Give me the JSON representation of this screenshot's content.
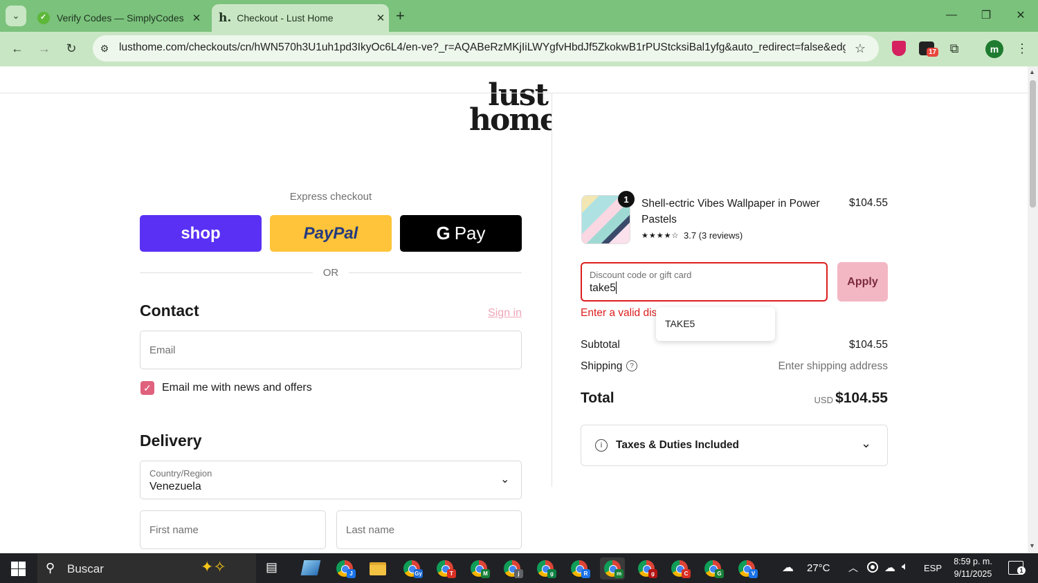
{
  "browser": {
    "tabs": [
      {
        "title": "Verify Codes — SimplyCodes"
      },
      {
        "title": "Checkout - Lust Home"
      }
    ],
    "new_tab": "+",
    "url": "lusthome.com/checkouts/cn/hWN570h3U1uh1pd3IkyOc6L4/en-ve?_r=AQABeRzMKjIiLWYgfvHbdJf5ZkokwB1rPUStcksiBal1yfg&auto_redirect=false&edg...",
    "extension_badge": "17",
    "profile_initial": "m"
  },
  "brand": {
    "line1": "lust",
    "line2": "home."
  },
  "express": {
    "label": "Express checkout",
    "shop": "shop",
    "paypal": "PayPal",
    "gpay": "Pay",
    "or": "OR"
  },
  "contact": {
    "title": "Contact",
    "sign_in": "Sign in",
    "email_placeholder": "Email",
    "newsletter": "Email me with news and offers"
  },
  "delivery": {
    "title": "Delivery",
    "country_label": "Country/Region",
    "country_value": "Venezuela",
    "first_name": "First name",
    "last_name": "Last name"
  },
  "summary": {
    "item": {
      "qty": "1",
      "name": "Shell-ectric Vibes Wallpaper in Power Pastels",
      "price": "$104.55",
      "stars": "★★★★☆",
      "rating": "3.7 (3 reviews)"
    },
    "discount": {
      "label": "Discount code or gift card",
      "value": "take5",
      "apply": "Apply",
      "error": "Enter a valid disc",
      "suggestion": "TAKE5"
    },
    "subtotal_label": "Subtotal",
    "subtotal_value": "$104.55",
    "shipping_label": "Shipping",
    "shipping_value": "Enter shipping address",
    "total_label": "Total",
    "currency": "USD",
    "total_value": "$104.55",
    "taxes": "Taxes & Duties Included"
  },
  "taskbar": {
    "search": "Buscar",
    "temperature": "27°C",
    "language": "ESP",
    "time": "8:59 p. m.",
    "date": "9/11/2025",
    "notifications": "1",
    "app_letters": [
      "J",
      "",
      "Gy",
      "T",
      "M",
      "j",
      "g",
      "R",
      "m",
      "g",
      "C",
      "G",
      "V"
    ]
  },
  "colors": {
    "accent_error": "#dd1d1d",
    "shop_purple": "#5a31f4",
    "paypal_yellow": "#ffc439",
    "sign_in": "#f0a5b7",
    "apply_bg": "#f3b7c3",
    "browser_green": "#7bc27c"
  }
}
